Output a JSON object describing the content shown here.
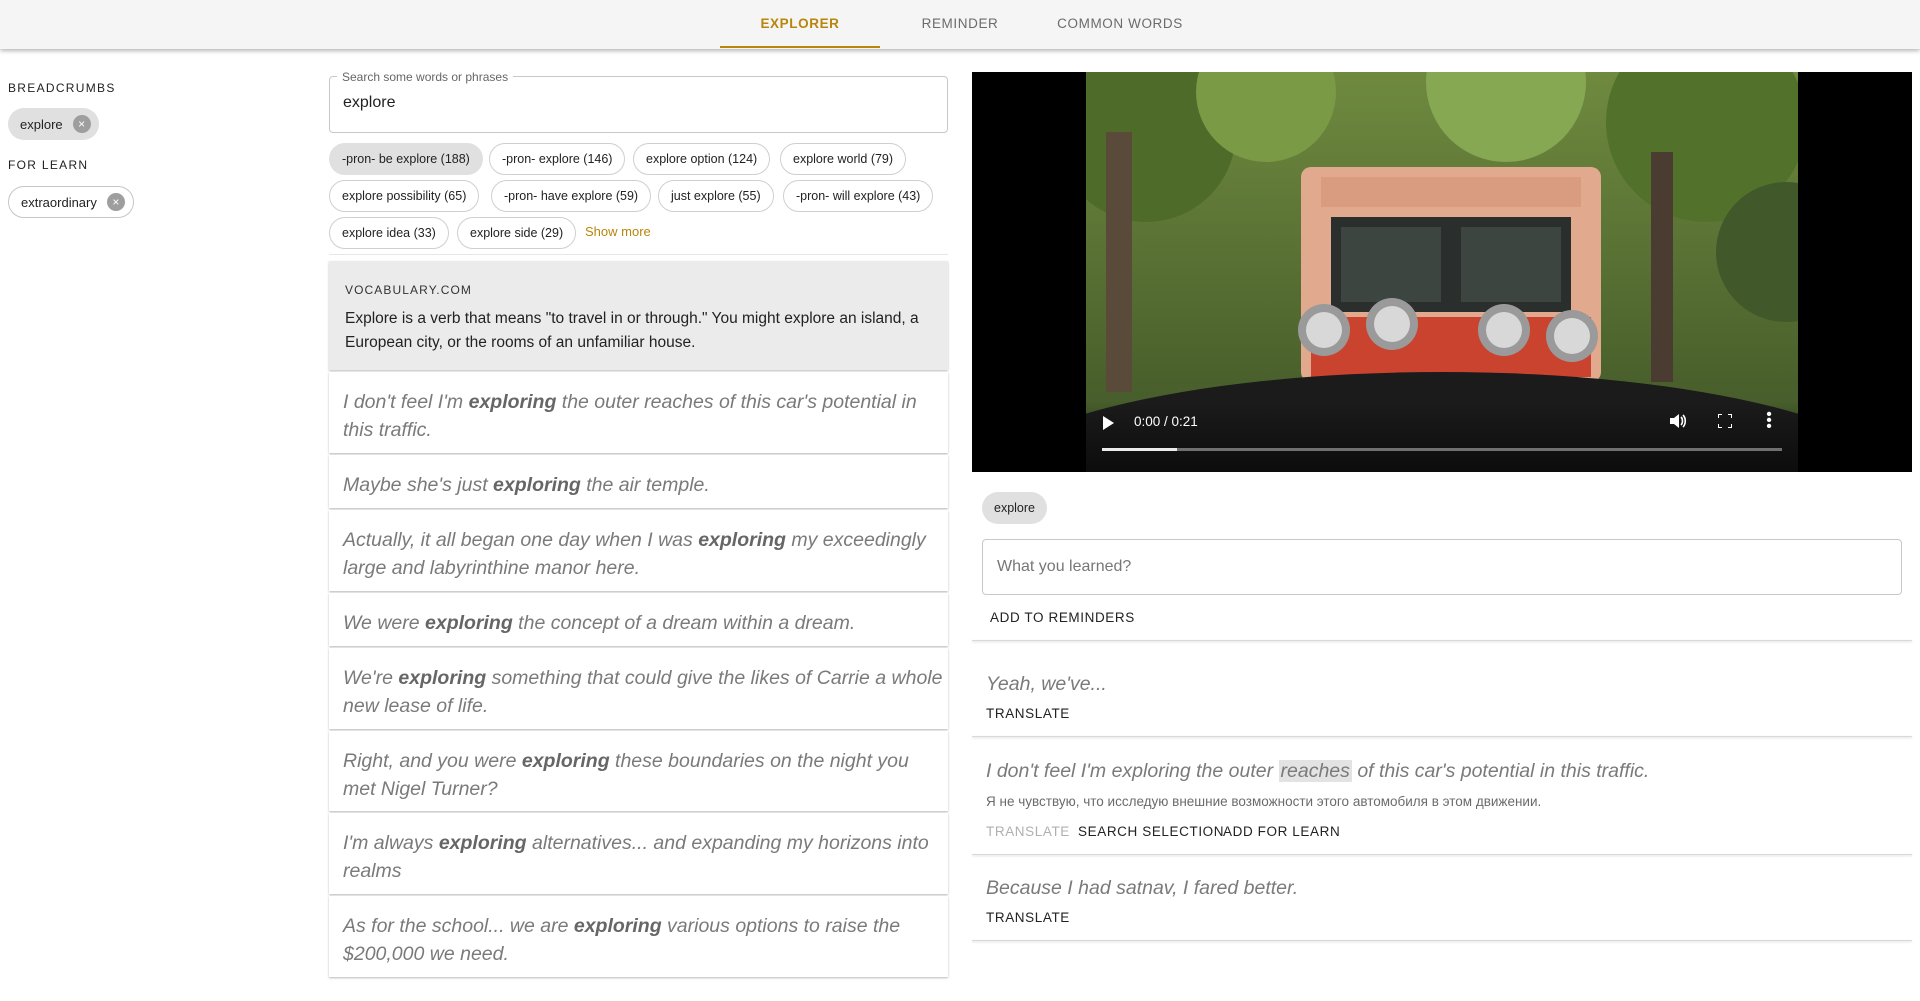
{
  "nav": {
    "tabs": [
      {
        "label": "EXPLORER",
        "active": true
      },
      {
        "label": "REMINDER",
        "active": false
      },
      {
        "label": "COMMON WORDS",
        "active": false
      }
    ],
    "accent_color": "#b8860b"
  },
  "sidebar": {
    "breadcrumbs_heading": "BREADCRUMBS",
    "breadcrumbs": [
      "explore"
    ],
    "for_learn_heading": "FOR LEARN",
    "for_learn": [
      "extraordinary"
    ]
  },
  "search": {
    "label": "Search some words or phrases",
    "value": "explore"
  },
  "phrases": [
    "-pron- be explore (188)",
    "-pron- explore (146)",
    "explore option (124)",
    "explore world (79)",
    "explore possibility (65)",
    "-pron- have explore (59)",
    "just explore (55)",
    "-pron- will explore (43)",
    "explore idea (33)",
    "explore side (29)"
  ],
  "show_more": "Show more",
  "vocab": {
    "source": "VOCABULARY.COM",
    "text": "Explore is a verb that means \"to travel in or through.\" You might explore an island, a European city, or the rooms of an unfamiliar house."
  },
  "examples": [
    {
      "before": "I don't feel I'm ",
      "keyword": "exploring",
      "after": " the outer reaches of this car's potential in this traffic."
    },
    {
      "before": "Maybe she's just ",
      "keyword": "exploring",
      "after": " the air temple."
    },
    {
      "before": "Actually, it all began one day when I was ",
      "keyword": "exploring",
      "after": " my exceedingly large and labyrinthine manor here."
    },
    {
      "before": "We were ",
      "keyword": "exploring",
      "after": " the concept of a dream within a dream."
    },
    {
      "before": "We're ",
      "keyword": "exploring",
      "after": " something that could give the likes of Carrie a whole new lease of life."
    },
    {
      "before": "Right, and you were ",
      "keyword": "exploring",
      "after": " these boundaries on the night you met Nigel Turner?"
    },
    {
      "before": "I'm always ",
      "keyword": "exploring",
      "after": " alternatives... and expanding my horizons into realms"
    },
    {
      "before": "As for the school... we are ",
      "keyword": "exploring",
      "after": " various options to raise the $200,000 we need."
    }
  ],
  "video": {
    "time": "0:00 / 0:21",
    "progress_fraction": 0.11
  },
  "word_chip": "explore",
  "learn_input": {
    "placeholder": "What you learned?"
  },
  "add_to_reminders": "ADD TO REMINDERS",
  "subtitles": {
    "first": {
      "text": "Yeah, we've...",
      "translate": "TRANSLATE"
    },
    "second": {
      "before": "I don't feel I'm exploring the outer ",
      "highlight": "reaches",
      "after": " of this car's potential in this traffic.",
      "translation": "Я не чувствую, что исследую внешние возможности этого автомобиля в этом движении.",
      "translate": "TRANSLATE",
      "search_selection": "SEARCH SELECTION",
      "add_for_learn": "ADD FOR LEARN"
    },
    "third": {
      "text": "Because I had satnav, I fared better.",
      "translate": "TRANSLATE"
    }
  }
}
